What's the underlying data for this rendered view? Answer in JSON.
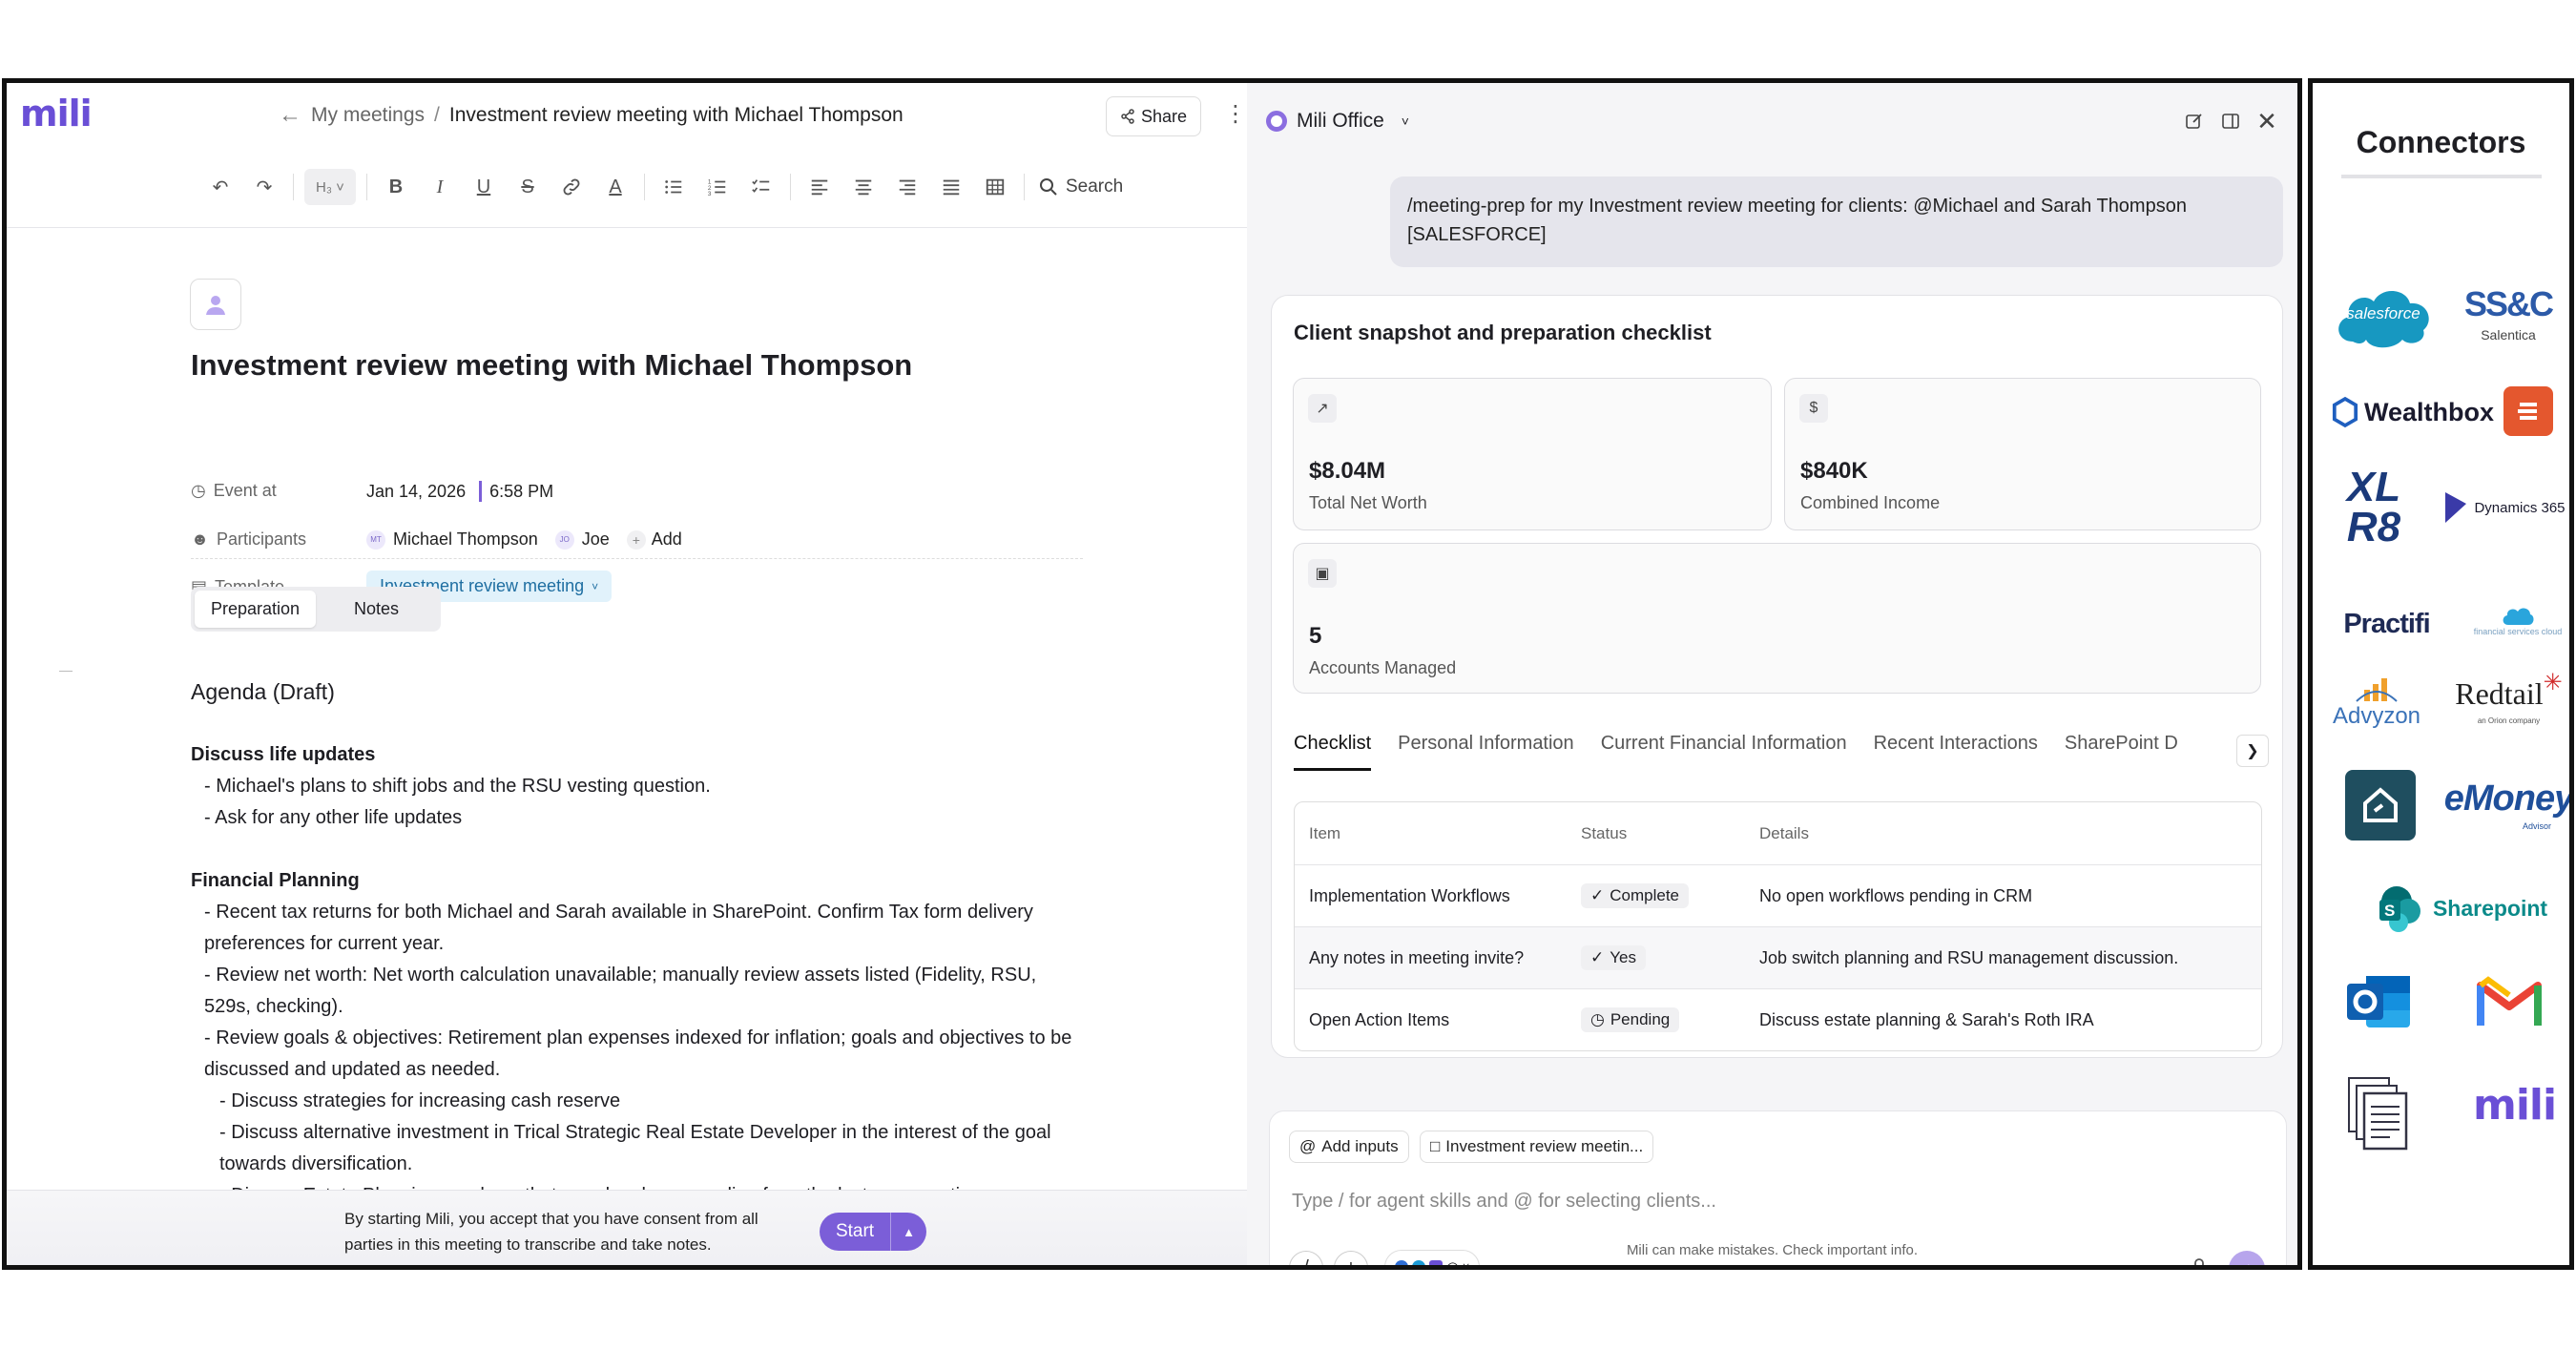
{
  "app": {
    "logo": "mili"
  },
  "breadcrumb": {
    "parent": "My meetings",
    "separator": "/",
    "current": "Investment review meeting with Michael Thompson"
  },
  "header": {
    "share_label": "Share"
  },
  "toolbar": {
    "heading_label": "H₃",
    "search_label": "Search"
  },
  "meeting": {
    "title": "Investment review meeting with Michael Thompson",
    "event_label": "Event at",
    "date": "Jan 14, 2026",
    "time": "6:58 PM",
    "participants_label": "Participants",
    "participants": [
      {
        "initials": "MT",
        "name": "Michael Thompson"
      },
      {
        "initials": "JO",
        "name": "Joe"
      }
    ],
    "add_label": "Add",
    "template_label": "Template",
    "template_value": "Investment review meeting"
  },
  "doc_tabs": [
    "Preparation",
    "Notes"
  ],
  "document": {
    "heading": "Agenda (Draft)",
    "lines": [
      {
        "style": "b",
        "text": "Discuss life updates"
      },
      {
        "style": "l1",
        "text": "- Michael's plans to shift jobs and the RSU vesting question."
      },
      {
        "style": "l1",
        "text": "- Ask for any other life updates"
      },
      {
        "style": "gap",
        "text": ""
      },
      {
        "style": "b",
        "text": "Financial Planning"
      },
      {
        "style": "l1",
        "text": "- Recent tax returns for both Michael and Sarah available in SharePoint. Confirm Tax form delivery preferences for current year."
      },
      {
        "style": "l1",
        "text": "- Review net worth: Net worth calculation unavailable; manually review assets listed (Fidelity, RSU, 529s, checking)."
      },
      {
        "style": "l1",
        "text": "- Review goals & objectives: Retirement plan expenses indexed for inflation; goals and objectives to be discussed and updated as needed."
      },
      {
        "style": "l2",
        "text": "- Discuss strategies for increasing cash reserve"
      },
      {
        "style": "l2",
        "text": "- Discuss alternative investment in Trical Strategic Real Estate Developer in the interest of the goal towards diversification."
      },
      {
        "style": "l2",
        "text": "- Discuss Estate Planning needs as that area has been pending from the last conversation"
      }
    ]
  },
  "footer": {
    "consent": "By starting Mili, you accept that you have consent from all parties in this meeting to transcribe and take notes.",
    "start_label": "Start"
  },
  "assistant": {
    "workspace": "Mili Office",
    "user_message": "/meeting-prep for my Investment review meeting for clients: @Michael and Sarah Thompson [SALESFORCE]",
    "card_title": "Client snapshot and preparation checklist",
    "stats": [
      {
        "icon": "trending-up-icon",
        "glyph": "↗",
        "value": "$8.04M",
        "label": "Total Net Worth"
      },
      {
        "icon": "dollar-icon",
        "glyph": "$",
        "value": "$840K",
        "label": "Combined Income"
      },
      {
        "icon": "briefcase-icon",
        "glyph": "▣",
        "value": "5",
        "label": "Accounts Managed"
      }
    ],
    "tabs": [
      "Checklist",
      "Personal Information",
      "Current Financial Information",
      "Recent Interactions",
      "SharePoint D"
    ],
    "table": {
      "headers": [
        "Item",
        "Status",
        "Details"
      ],
      "rows": [
        {
          "item": "Implementation Workflows",
          "status": "Complete",
          "status_icon": "✓",
          "details": "No open workflows pending in CRM"
        },
        {
          "item": "Any notes in meeting invite?",
          "status": "Yes",
          "status_icon": "✓",
          "details": "Job switch planning and RSU management discussion."
        },
        {
          "item": "Open Action Items",
          "status": "Pending",
          "status_icon": "◷",
          "details": "Discuss estate planning & Sarah's Roth IRA"
        }
      ]
    },
    "composer": {
      "add_inputs": "Add inputs",
      "meeting_chip": "Investment review meetin...",
      "placeholder": "Type / for agent skills and @ for selecting clients...",
      "slash": "/",
      "plus": "+"
    },
    "disclaimer": "Mili can make mistakes. Check important info."
  },
  "connectors": {
    "title": "Connectors",
    "items": [
      "salesforce",
      "SS&C",
      "Salentica",
      "Wealthbox",
      "XL R8",
      "Dynamics 365",
      "Practifi",
      "financial services cloud",
      "Advyzon",
      "Redtail",
      "an Orion company",
      "eMoney",
      "Advisor",
      "Sharepoint",
      "mili"
    ]
  },
  "colors": {
    "accent": "#7b5ed8",
    "salesforce": "#1798c1",
    "template_bg": "#e1f2fb"
  }
}
